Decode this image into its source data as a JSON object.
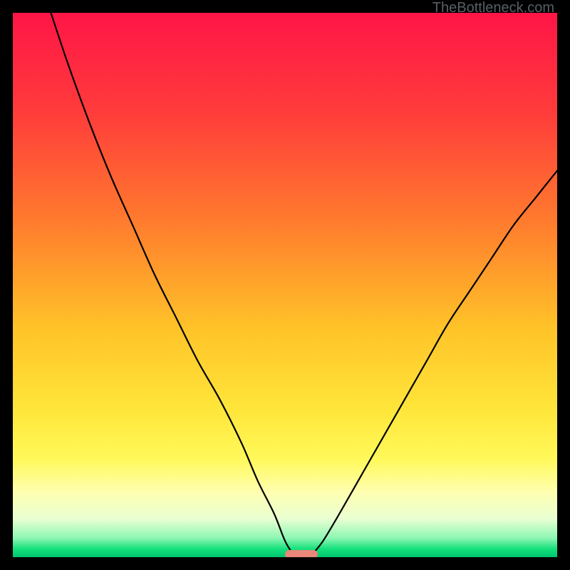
{
  "watermark": "TheBottleneck.com",
  "chart_data": {
    "type": "line",
    "title": "",
    "xlabel": "",
    "ylabel": "",
    "xlim": [
      0,
      100
    ],
    "ylim": [
      0,
      100
    ],
    "grid": false,
    "legend": false,
    "gradient_stops": [
      {
        "pos": 0.0,
        "color": "#ff1547"
      },
      {
        "pos": 0.18,
        "color": "#ff3b3b"
      },
      {
        "pos": 0.38,
        "color": "#ff7a2e"
      },
      {
        "pos": 0.58,
        "color": "#ffc328"
      },
      {
        "pos": 0.73,
        "color": "#ffe63a"
      },
      {
        "pos": 0.82,
        "color": "#fff95a"
      },
      {
        "pos": 0.88,
        "color": "#ffffb0"
      },
      {
        "pos": 0.93,
        "color": "#e9ffd2"
      },
      {
        "pos": 0.965,
        "color": "#8cf7b2"
      },
      {
        "pos": 0.985,
        "color": "#14e07b"
      },
      {
        "pos": 1.0,
        "color": "#00c470"
      }
    ],
    "series": [
      {
        "name": "left-branch",
        "x": [
          7,
          10,
          14,
          18,
          22,
          26,
          30,
          34,
          38,
          42,
          45,
          48,
          50,
          51.5
        ],
        "y": [
          100,
          91,
          80,
          70,
          61,
          52,
          44,
          36,
          29,
          21,
          14,
          8,
          3,
          0.5
        ]
      },
      {
        "name": "right-branch",
        "x": [
          55,
          57,
          60,
          64,
          68,
          72,
          76,
          80,
          84,
          88,
          92,
          96,
          100
        ],
        "y": [
          0.5,
          3,
          8,
          15,
          22,
          29,
          36,
          43,
          49,
          55,
          61,
          66,
          71
        ]
      }
    ],
    "marker": {
      "x_start": 50,
      "x_end": 56,
      "y": 0.5,
      "color": "#e8877a"
    }
  }
}
